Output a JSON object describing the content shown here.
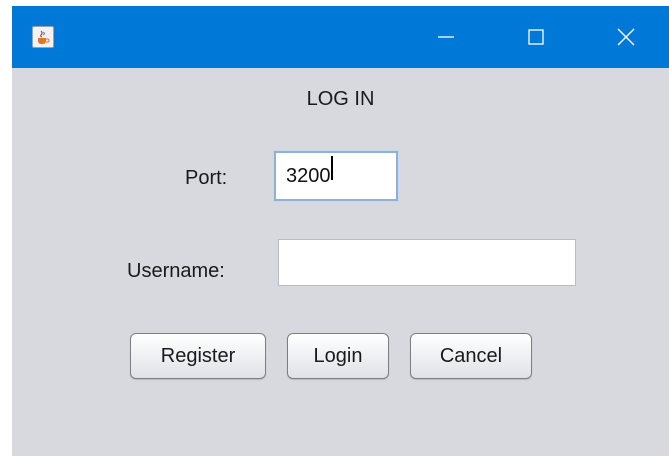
{
  "window": {
    "title_icon": "java-cup-icon",
    "controls": {
      "minimize": "minimize-icon",
      "maximize": "maximize-icon",
      "close": "close-icon"
    },
    "titlebar_color": "#0078d7",
    "background_color": "#d7d9df"
  },
  "form": {
    "heading": "LOG IN",
    "port_label": "Port:",
    "port_value": "3200",
    "username_label": "Username:",
    "username_value": ""
  },
  "buttons": {
    "register": "Register",
    "login": "Login",
    "cancel": "Cancel"
  }
}
